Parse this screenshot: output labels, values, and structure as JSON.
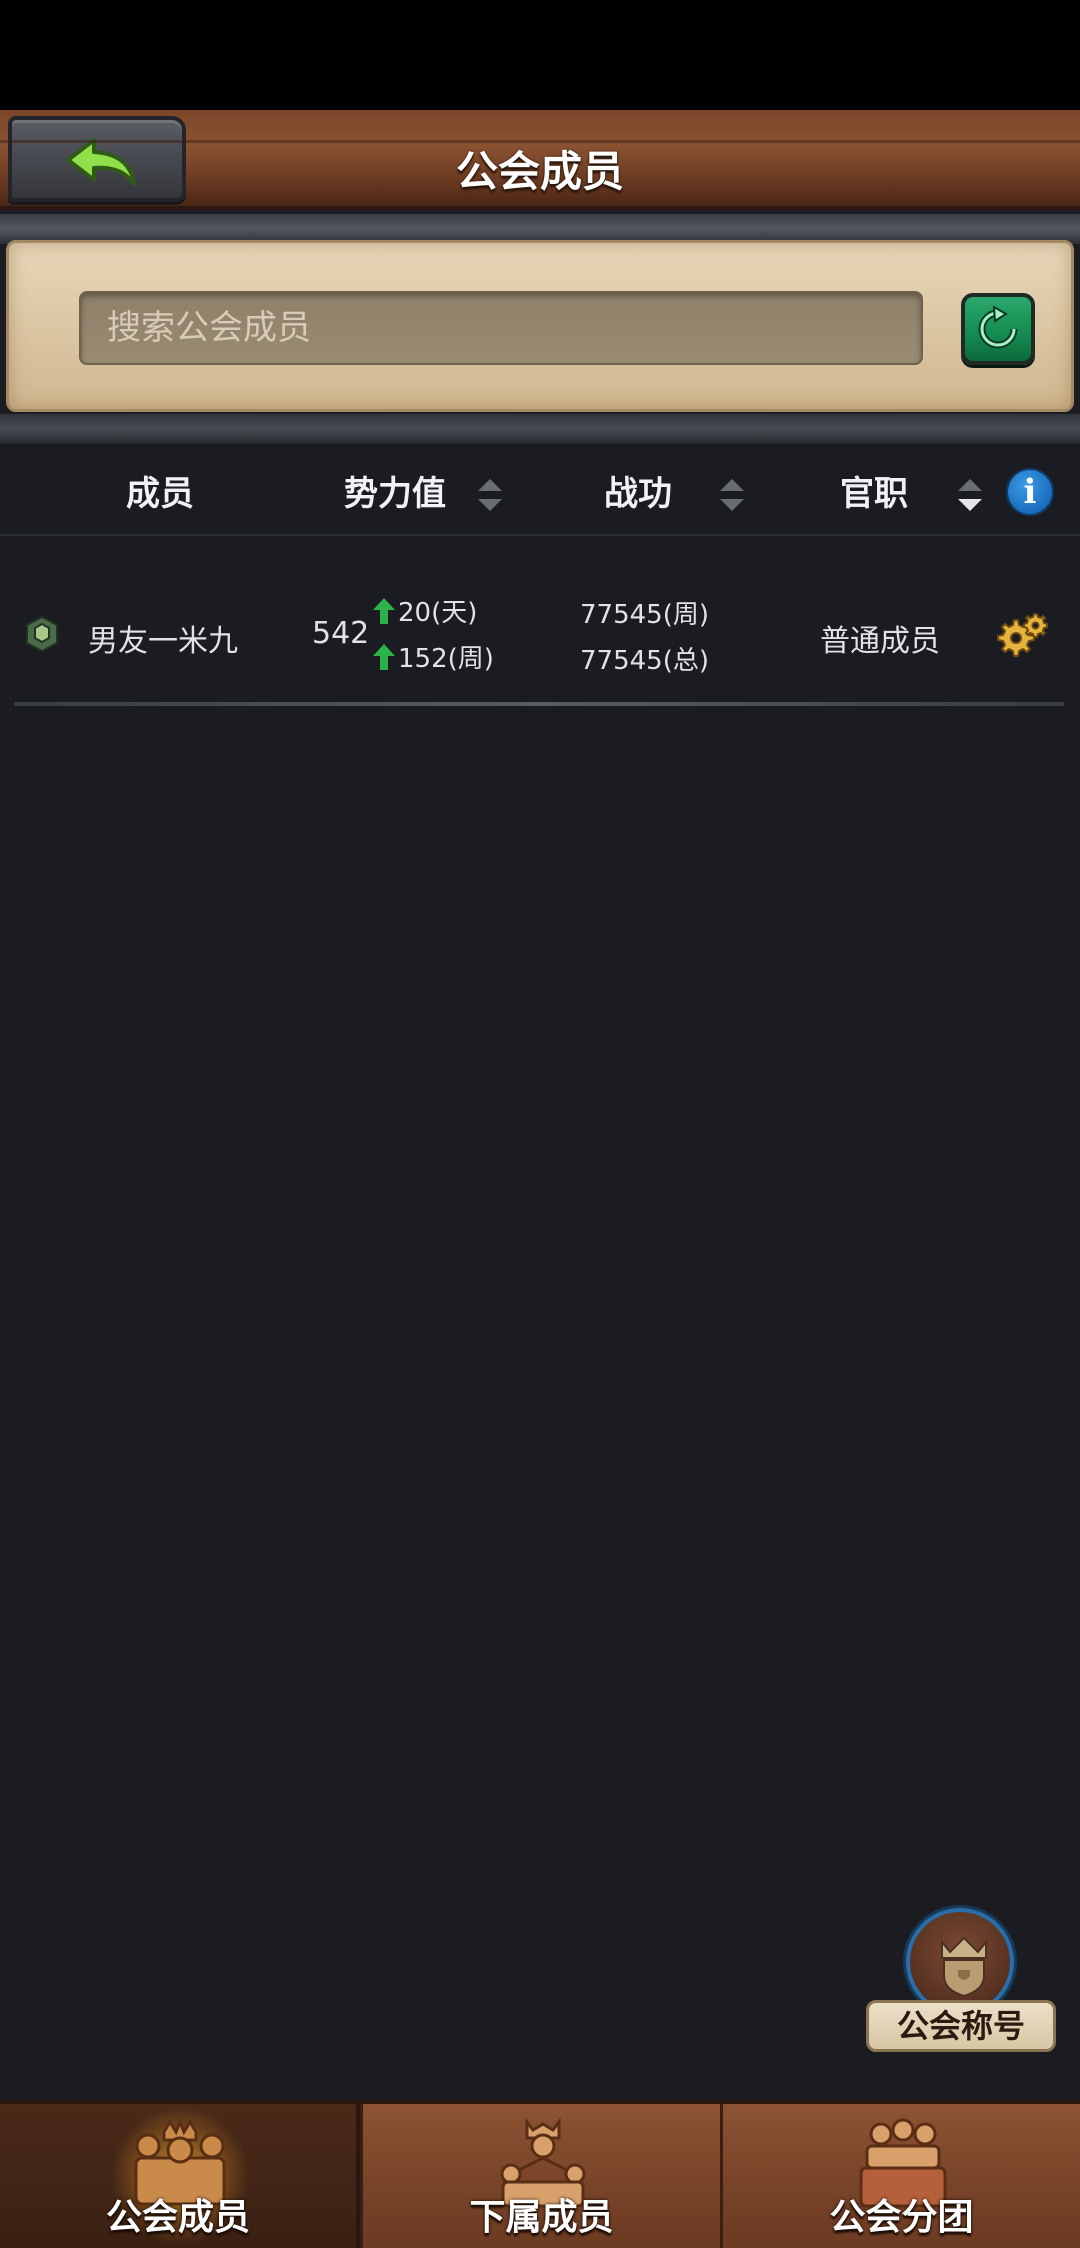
{
  "header": {
    "title": "公会成员"
  },
  "search": {
    "placeholder": "搜索公会成员"
  },
  "columns": {
    "member": "成员",
    "power": "势力值",
    "merit": "战功",
    "position": "官职"
  },
  "members": [
    {
      "name": "男友一米九",
      "power": "542",
      "power_day": "20(天)",
      "power_week": "152(周)",
      "merit_week": "77545(周)",
      "merit_total": "77545(总)",
      "position": "普通成员"
    }
  ],
  "title_button": {
    "label": "公会称号"
  },
  "tabs": [
    {
      "label": "公会成员",
      "active": true
    },
    {
      "label": "下属成员",
      "active": false
    },
    {
      "label": "公会分团",
      "active": false
    }
  ],
  "colors": {
    "accent_green": "#2bb34a",
    "info_blue": "#1b6dbd",
    "wood": "#7a4529"
  }
}
